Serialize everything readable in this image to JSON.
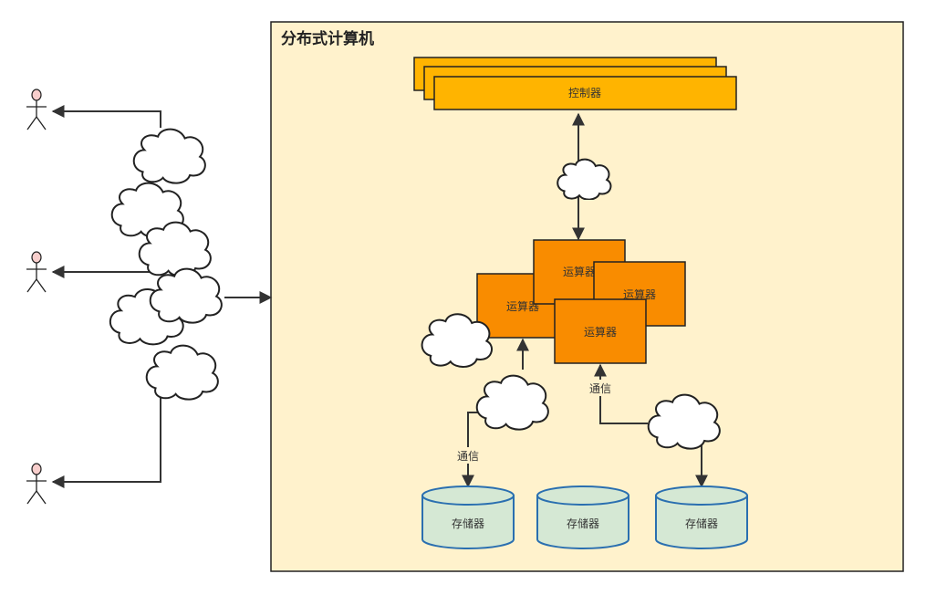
{
  "diagram": {
    "title": "分布式计算机",
    "controller_label": "控制器",
    "processor_labels": [
      "运算器",
      "运算器",
      "运算器",
      "运算器"
    ],
    "storage_labels": [
      "存储器",
      "存储器",
      "存储器"
    ],
    "comm_labels": [
      "通信",
      "通信"
    ]
  },
  "colors": {
    "container_fill": "#fff2cc",
    "controller_fill": "#ffb400",
    "processor_fill": "#f98c00",
    "storage_fill": "#d5e8d4",
    "storage_stroke": "#2a6fb0",
    "actor_head": "#f8cecc"
  },
  "icons": {
    "users": [
      "user-actor-icon",
      "user-actor-icon",
      "user-actor-icon"
    ],
    "clouds": "cloud-icon"
  }
}
